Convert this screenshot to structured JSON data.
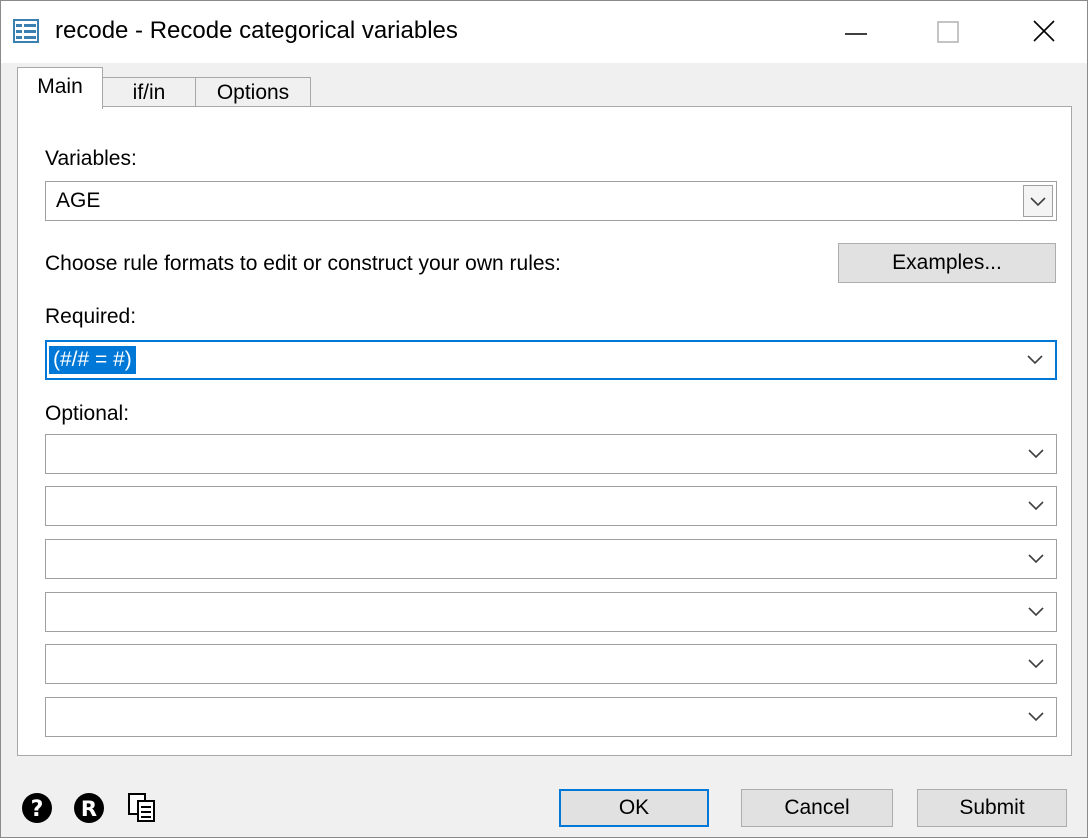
{
  "window": {
    "title": "recode - Recode categorical variables",
    "icon": "dialog-form-icon",
    "controls": [
      "minimize-icon",
      "maximize-icon",
      "close-icon"
    ]
  },
  "tabs": [
    {
      "label": "Main",
      "active": true
    },
    {
      "label": "if/in",
      "active": false
    },
    {
      "label": "Options",
      "active": false
    }
  ],
  "main": {
    "variables_label": "Variables:",
    "variables_value": "AGE",
    "instruction": "Choose rule formats to edit or construct your own rules:",
    "examples_button": "Examples...",
    "required_label": "Required:",
    "required_value": "(#/# = #)",
    "optional_label": "Optional:",
    "optional_values": [
      "",
      "",
      "",
      "",
      "",
      ""
    ]
  },
  "footer": {
    "icons": [
      "help-icon",
      "r-icon",
      "copy-icon"
    ],
    "ok": "OK",
    "cancel": "Cancel",
    "submit": "Submit"
  },
  "colors": {
    "accent": "#0078d7",
    "panel": "#ffffff",
    "chrome": "#f0f0f0"
  }
}
